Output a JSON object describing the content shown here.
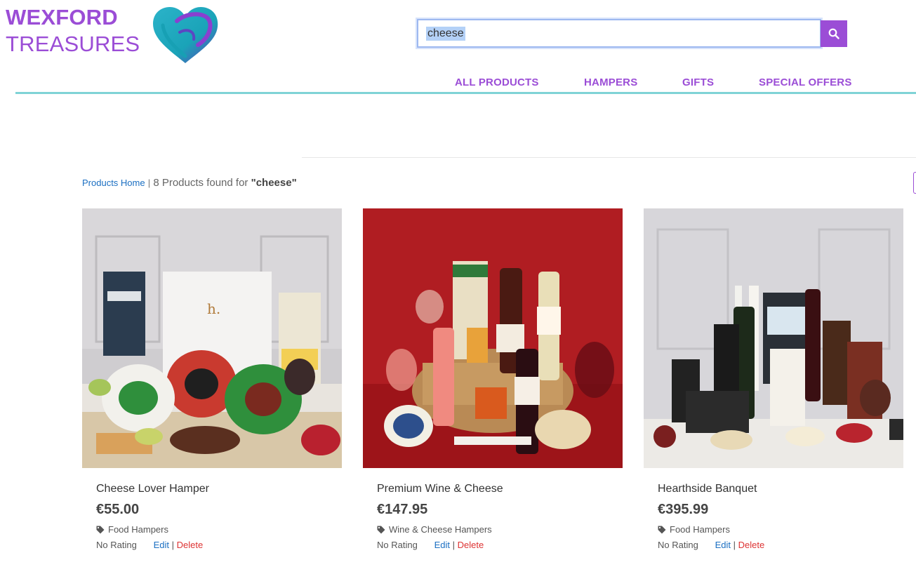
{
  "brand": {
    "line1": "WEXFORD",
    "line2": "TREASURES",
    "logo_icon": "heart-logo",
    "color_primary": "#9b4dd6",
    "color_accent": "#7fd3d6"
  },
  "search": {
    "value": "cheese",
    "button_icon": "search-icon"
  },
  "nav": {
    "items": [
      "ALL PRODUCTS",
      "HAMPERS",
      "GIFTS",
      "SPECIAL OFFERS"
    ]
  },
  "breadcrumb": {
    "home_label": "Products Home",
    "separator": "|",
    "result_text": "8 Products found for",
    "query": "\"cheese\""
  },
  "products": [
    {
      "title": "Cheese Lover Hamper",
      "price": "€55.00",
      "category": "Food Hampers",
      "rating": "No Rating",
      "edit_label": "Edit",
      "separator": "|",
      "delete_label": "Delete"
    },
    {
      "title": "Premium Wine & Cheese",
      "price": "€147.95",
      "category": "Wine & Cheese Hampers",
      "rating": "No Rating",
      "edit_label": "Edit",
      "separator": "|",
      "delete_label": "Delete"
    },
    {
      "title": "Hearthside Banquet",
      "price": "€395.99",
      "category": "Food Hampers",
      "rating": "No Rating",
      "edit_label": "Edit",
      "separator": "|",
      "delete_label": "Delete"
    }
  ]
}
